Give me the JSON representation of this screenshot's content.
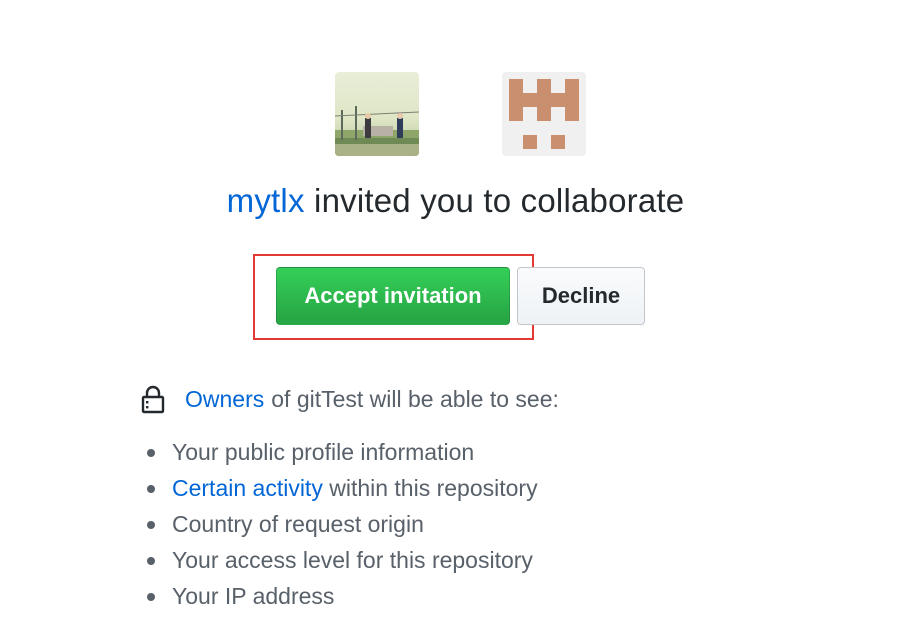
{
  "inviter_avatar": {
    "icon": "inviter-avatar-photo"
  },
  "repo_avatar": {
    "icon": "identicon",
    "color": "#c98f6e"
  },
  "heading": {
    "inviter": "mytlx",
    "text": "invited you to collaborate"
  },
  "actions": {
    "accept_label": "Accept invitation",
    "decline_label": "Decline",
    "accept_color": "#28a745",
    "highlight_color": "#e53935"
  },
  "owners": {
    "icon": "lock-icon",
    "link_label": "Owners",
    "text": "of gitTest will be able to see:"
  },
  "info_items": [
    {
      "text": "Your public profile information"
    },
    {
      "link": "Certain activity",
      "text": " within this repository"
    },
    {
      "text": "Country of request origin"
    },
    {
      "text": "Your access level for this repository"
    },
    {
      "text": "Your IP address"
    }
  ]
}
